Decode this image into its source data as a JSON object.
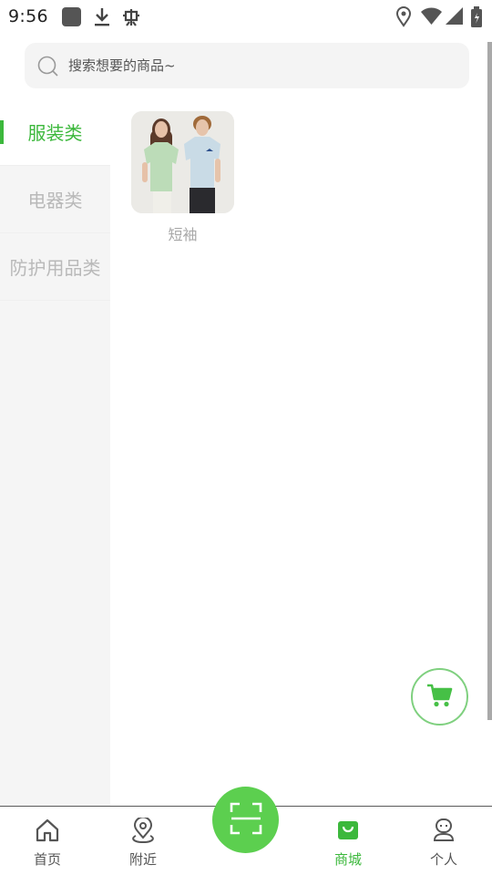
{
  "status_bar": {
    "time": "9:56",
    "left_icons": [
      "app-square-icon",
      "download-icon",
      "bug-icon"
    ],
    "right_icons": [
      "location-icon",
      "wifi-icon",
      "signal-icon",
      "battery-icon"
    ]
  },
  "search": {
    "placeholder": "搜索想要的商品~"
  },
  "categories": [
    {
      "label": "服装类",
      "active": true
    },
    {
      "label": "电器类",
      "active": false
    },
    {
      "label": "防护用品类",
      "active": false
    }
  ],
  "products": [
    {
      "name": "短袖",
      "image": "two-people-tshirts-photo"
    }
  ],
  "cart_button": {
    "icon": "shopping-cart-icon"
  },
  "bottom_nav": {
    "items": [
      {
        "label": "首页",
        "icon": "home-icon",
        "active": false
      },
      {
        "label": "附近",
        "icon": "map-pin-icon",
        "active": false
      },
      {
        "label": "商城",
        "icon": "shopping-bag-icon",
        "active": true
      },
      {
        "label": "个人",
        "icon": "profile-icon",
        "active": false
      }
    ],
    "center_button": {
      "icon": "scan-icon"
    }
  },
  "colors": {
    "accent": "#3cb83c",
    "scan_button": "#5ccf4f",
    "sidebar_bg": "#f5f5f5",
    "search_bg": "#f4f4f4"
  }
}
